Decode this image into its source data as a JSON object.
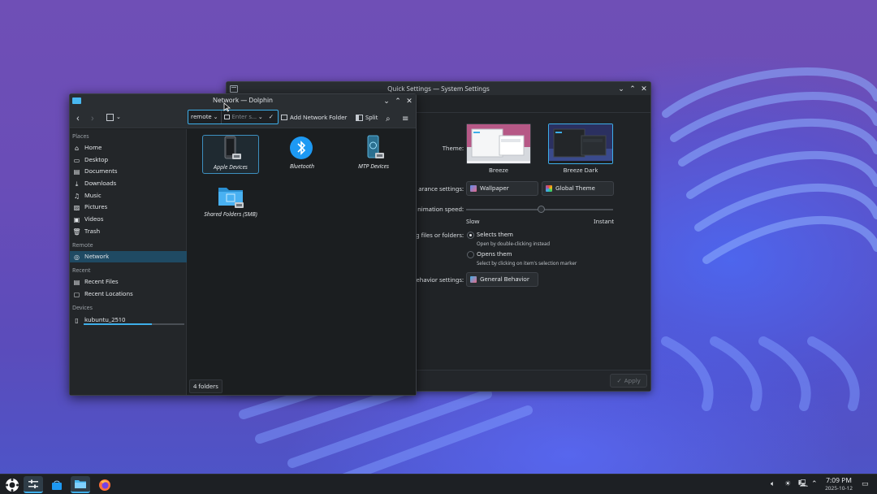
{
  "system_settings": {
    "title": "Quick Settings — System Settings",
    "theme_label": "Theme:",
    "themes": [
      {
        "name": "Breeze",
        "selected": false
      },
      {
        "name": "Breeze Dark",
        "selected": true
      }
    ],
    "appearance_label": "arance settings:",
    "wallpaper_button": "Wallpaper",
    "global_theme_button": "Global Theme",
    "animation_label": "nimation speed:",
    "animation_slow": "Slow",
    "animation_instant": "Instant",
    "animation_level": 0.51,
    "click_label": "g files or folders:",
    "click_options": [
      {
        "label": "Selects them",
        "note": "Open by double-clicking instead",
        "checked": true
      },
      {
        "label": "Opens them",
        "note": "Select by clicking on item's selection marker",
        "checked": false
      }
    ],
    "behavior_label": "Behavior settings:",
    "general_behavior_button": "General Behavior",
    "apply_button": "Apply"
  },
  "dolphin": {
    "title": "Network — Dolphin",
    "address_segment": "remote",
    "address_placeholder": "Enter s...",
    "add_network_folder": "Add Network Folder",
    "split": "Split",
    "sidebar": {
      "places_header": "Places",
      "places": [
        {
          "label": "Home",
          "icon": "home-icon"
        },
        {
          "label": "Desktop",
          "icon": "desktop-icon"
        },
        {
          "label": "Documents",
          "icon": "documents-icon"
        },
        {
          "label": "Downloads",
          "icon": "downloads-icon"
        },
        {
          "label": "Music",
          "icon": "music-icon"
        },
        {
          "label": "Pictures",
          "icon": "pictures-icon"
        },
        {
          "label": "Videos",
          "icon": "videos-icon"
        },
        {
          "label": "Trash",
          "icon": "trash-icon"
        }
      ],
      "remote_header": "Remote",
      "remote": [
        {
          "label": "Network",
          "icon": "network-icon",
          "active": true
        }
      ],
      "recent_header": "Recent",
      "recent": [
        {
          "label": "Recent Files",
          "icon": "recent-files-icon"
        },
        {
          "label": "Recent Locations",
          "icon": "recent-locations-icon"
        }
      ],
      "devices_header": "Devices",
      "devices": [
        {
          "label": "kubuntu_2510",
          "icon": "drive-icon",
          "usage": 0.68
        }
      ]
    },
    "items": [
      {
        "label": "Apple Devices",
        "icon": "phone-icon",
        "selected": true
      },
      {
        "label": "Bluetooth",
        "icon": "bluetooth-icon",
        "selected": false
      },
      {
        "label": "MTP Devices",
        "icon": "mtp-device-icon",
        "selected": false
      },
      {
        "label": "Shared Folders (SMB)",
        "icon": "network-folder-icon",
        "selected": false
      }
    ],
    "status": "4 folders"
  },
  "taskbar": {
    "time": "7:09 PM",
    "date": "2025-10-12"
  },
  "colors": {
    "accent": "#3daee9",
    "window_bg": "#1b1e20",
    "titlebar_bg": "#2a2e32",
    "taskbar_bg": "#1d2024"
  }
}
